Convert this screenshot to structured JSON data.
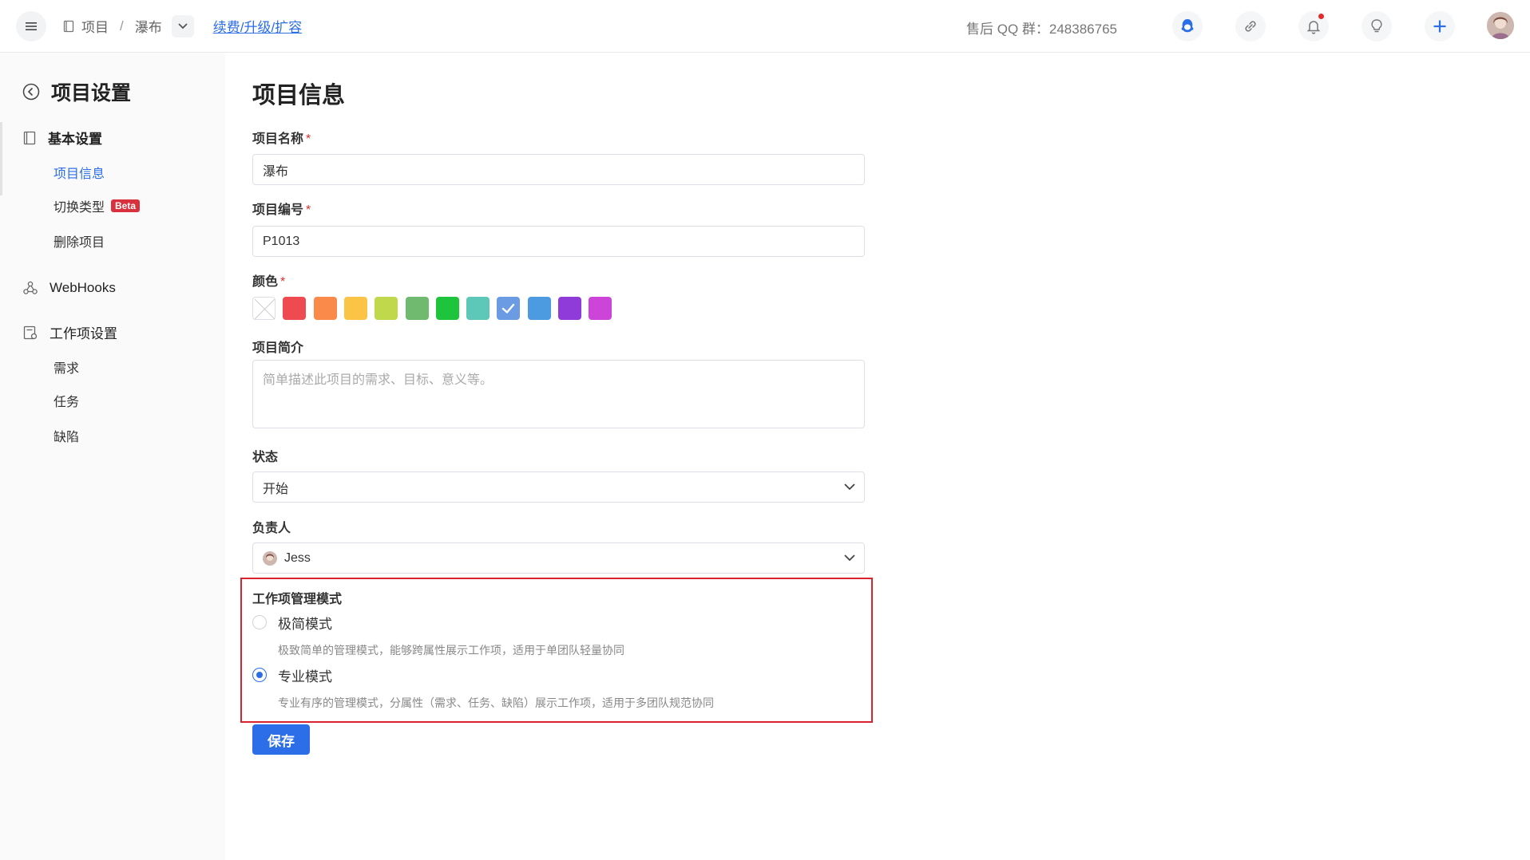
{
  "header": {
    "crumbs": [
      "项目",
      "瀑布"
    ],
    "separator": "/",
    "renew_link": "续费/升级/扩容",
    "qq_group": "售后 QQ 群：248386765"
  },
  "sidebar": {
    "title": "项目设置",
    "groups": [
      {
        "label": "基本设置",
        "items": [
          "项目信息",
          "切换类型",
          "删除项目"
        ]
      },
      {
        "label": "WebHooks",
        "items": []
      },
      {
        "label": "工作项设置",
        "items": [
          "需求",
          "任务",
          "缺陷"
        ]
      }
    ],
    "beta_badge": "Beta",
    "active_item": "项目信息"
  },
  "main": {
    "title": "项目信息",
    "fields": {
      "name": {
        "label": "项目名称",
        "required": "*",
        "value": "瀑布"
      },
      "code": {
        "label": "项目编号",
        "required": "*",
        "value": "P1013"
      },
      "color": {
        "label": "颜色",
        "required": "*"
      },
      "intro": {
        "label": "项目简介",
        "placeholder": "简单描述此项目的需求、目标、意义等。"
      },
      "status": {
        "label": "状态",
        "value": "开始"
      },
      "owner": {
        "label": "负责人",
        "value": "Jess"
      }
    },
    "colors": [
      "none",
      "#ef4a4f",
      "#f98a49",
      "#fcc447",
      "#c0d84c",
      "#6fba6f",
      "#1ec43c",
      "#5dc8b7",
      "#6a9be3",
      "#4c9be1",
      "#8e3bd9",
      "#cc44d8"
    ],
    "selected_color": "#6a9be3",
    "mode": {
      "label": "工作项管理模式",
      "options": [
        {
          "label": "极简模式",
          "desc": "极致简单的管理模式，能够跨属性展示工作项，适用于单团队轻量协同",
          "checked": false
        },
        {
          "label": "专业模式",
          "desc": "专业有序的管理模式，分属性（需求、任务、缺陷）展示工作项，适用于多团队规范协同",
          "checked": true
        }
      ]
    },
    "save_label": "保存"
  }
}
